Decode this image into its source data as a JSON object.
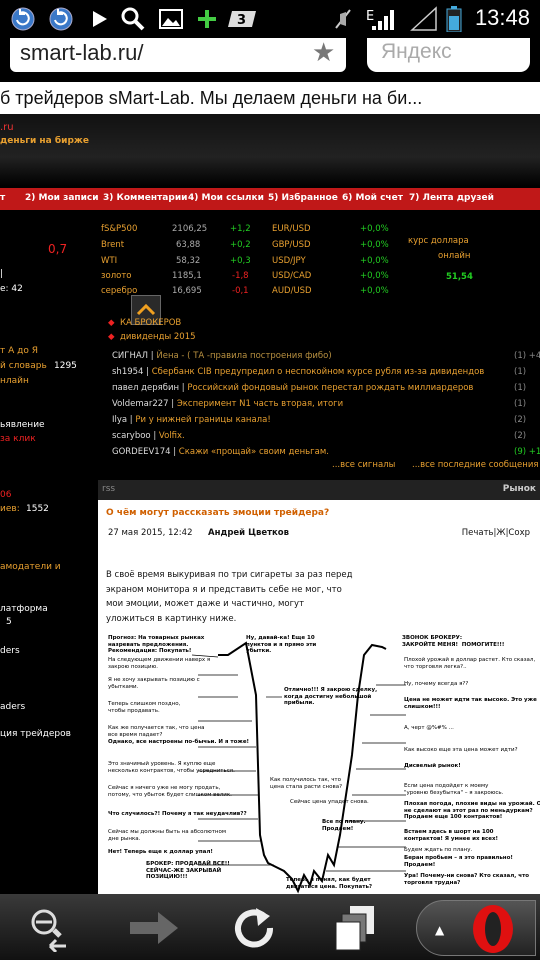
{
  "status": {
    "time": "13:48",
    "network": "E"
  },
  "browser": {
    "url": "smart-lab.ru/",
    "search_placeholder": "Яндекс",
    "tab_title": "б трейдеров sMart-Lab. Мы делаем деньги на би..."
  },
  "site": {
    "header_line1": ".ru",
    "header_line2": "деньги на бирже"
  },
  "menu": [
    "т",
    "2) Мои записи",
    "3) Комментарии",
    "4) Мои ссылки",
    "5) Избранное",
    "6) Мой счет",
    "7) Лента друзей"
  ],
  "left": {
    "value_red": "0,7",
    "e_val": "е: 42",
    "a_to_ya": "т А до Я",
    "dict": "й словарь",
    "dict_count": "1295",
    "online": "нлайн",
    "announce": "ьявление",
    "za_klik": "за клик",
    "v06": "06",
    "iev": "иев:",
    "iev_val": "1552",
    "amod": "амодатели  и",
    "latf": "латформа",
    "five": "5",
    "ders": "ders",
    "aders": "aders",
    "cii": "ция трейдеров"
  },
  "markets": {
    "indices": [
      {
        "name": "fS&P500",
        "value": "2106,25",
        "change": "+1,2"
      },
      {
        "name": "Brent",
        "value": "63,88",
        "change": "+0,2"
      },
      {
        "name": "WTI",
        "value": "58,32",
        "change": "+0,3"
      },
      {
        "name": "золото",
        "value": "1185,1",
        "change": "-1,8"
      },
      {
        "name": "серебро",
        "value": "16,695",
        "change": "-0,1"
      }
    ],
    "currencies": [
      {
        "name": "EUR/USD",
        "change": "+0,0%"
      },
      {
        "name": "GBP/USD",
        "change": "+0,0%"
      },
      {
        "name": "USD/JPY",
        "change": "+0,0%"
      },
      {
        "name": "USD/CAD",
        "change": "+0,0%"
      },
      {
        "name": "AUD/USD",
        "change": "+0,0%"
      }
    ],
    "usd_label_1": "курс доллара",
    "usd_label_2": "онлайн",
    "usd_value": "51,54"
  },
  "links": {
    "brokers": "КА          БРОКЕРОВ",
    "dividends": "дивиденды  2015"
  },
  "signals": [
    {
      "user": "СИГНАЛ",
      "text": "Йена - ( ТА -правила  построения фибо)",
      "count": "(1) +4"
    },
    {
      "user": "sh1954",
      "text": "Сбербанк  CIB  предупредил  о неспокойном  курсе рубля  из-за  дивидендов",
      "count": "(1)"
    },
    {
      "user": "павел дерябин",
      "text": "Российский фондовый рынок перестал  рождать  миллиардеров",
      "count": "(1)"
    },
    {
      "user": "Voldemar227",
      "text": "Эксперимент  N1  часть вторая,  итоги",
      "count": "(1)"
    },
    {
      "user": "Ilya",
      "text": "Ри  у  нижней границы канала!",
      "count": "(2)"
    },
    {
      "user": "scaryboo",
      "text": "Volfix.",
      "count": "(2)"
    },
    {
      "user": "GORDEEV174",
      "text": "Скажи  «прощай»  своим  деньгам.",
      "count": "(9) +12"
    }
  ],
  "all_signals": "...все  сигналы",
  "all_posts": "...все  последние  сообщения",
  "rss": {
    "left": "rss",
    "right": "Рынок"
  },
  "article": {
    "title": "О  чём  могут  рассказать  эмоции трейдера?",
    "date": "27 мая  2015,  12:42",
    "author": "Андрей  Цветков",
    "tools": "Печать|Ж|Сохр",
    "para": "В своё время выкуривая по три сигареты за раз перед экраном монитора я и представить себе не мог, что мои эмоции, может даже и частично, могут уложиться в картинку ниже."
  },
  "diagram_notes": [
    "Прогноз: На товарных рынках\nназревать предложения.\nРекомендация: Покупать!",
    "Ну, давай-ка! Еще 10\nпунктов и я прямо эти\nубытки.",
    "ЗВОНОК БРОКЕРУ:\nЗАКРОЙТЕ МЕНЯ!  ПОМОГИТЕ!!!",
    "На следующем движении наверх я\nзакрою позицию.",
    "Плохой урожай в доллар растет. Кто сказал,\nчто торговля легка?..",
    "Я не хочу закрывать позицию с\nубытками.",
    "Отлично!!! Я закрою сделку,\nкогда достигну небольшой\nприбыли.",
    "Ну, почему всегда я??",
    "Теперь слишком поздно,\nчтобы продавать.",
    "Цена не может идти так высоко. Это уже\nслишком!!!",
    "Как же получается так, что цена\nвсе время падает?",
    "А, черт @%#% ...",
    "Однако, все настроены по-бычьи. И я тоже!",
    "Как высоко еще эта цена может идти?",
    "Это значимый уровень. Я куплю еще\nнесколько контрактов, чтобы усредниться.",
    "Дисвелый рынок!",
    "Сейчас я ничего уже не могу продать,\nпотому, что убыток будет слишком велик.",
    "Как получилось так, что\nцена стала расти снова?",
    "Если цена подойдет к моему\n\"уровню безубытка\" – я закроюсь.",
    "Что случилось?! Почему я так неудачлив??",
    "Сейчас цена упадет снова.",
    "Плохая погода, плохие виды на урожай. Они\nне сделают на этот раз по меньдуркам?\nПродаем еще 100 контрактов!",
    "Сейчас мы должны быть на абсолютном\nдне рынка.",
    "Все по плану.\nПродаем!",
    "Встаем здесь в шорт на 100\nконтрактов! Я умнее их всех!",
    "Нет! Теперь еще к доллар упал!",
    "Будем ждать по плану.",
    "Беран пробьем – я это правильно!\nПродаем!",
    "БРОКЕР: ПРОДАВАЙ ВСЕ!!\nСЕЙЧАС-ЖЕ ЗАКРЫВАЙ\nПОЗИЦИЮ!!!",
    "Ура! Почему-ни снова? Кто сказал, что\nторговля трудна?",
    "Теперь я понял, как будет\nдвигаться цена. Покупать?"
  ]
}
